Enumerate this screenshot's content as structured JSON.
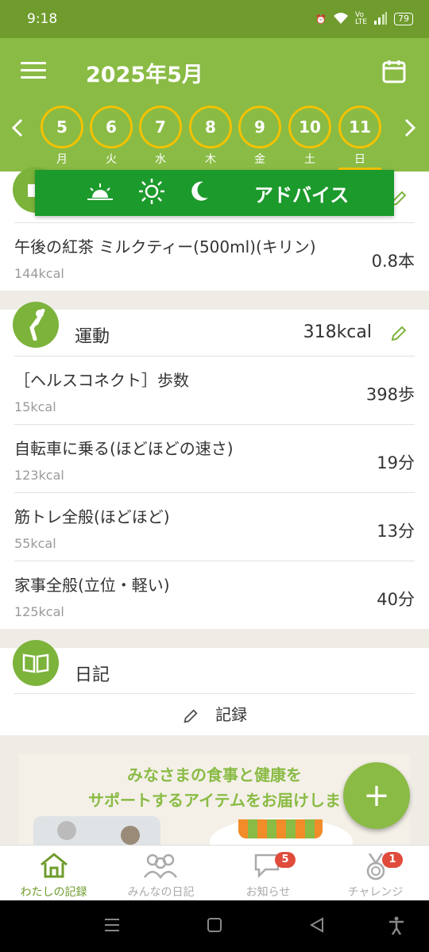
{
  "status": {
    "time": "9:18",
    "battery": "79"
  },
  "header": {
    "title": "2025年5月"
  },
  "days": [
    {
      "num": "5",
      "weekday": "月"
    },
    {
      "num": "6",
      "weekday": "火"
    },
    {
      "num": "7",
      "weekday": "水"
    },
    {
      "num": "8",
      "weekday": "木"
    },
    {
      "num": "9",
      "weekday": "金"
    },
    {
      "num": "10",
      "weekday": "土"
    },
    {
      "num": "11",
      "weekday": "日"
    }
  ],
  "advice": {
    "label": "アドバイス"
  },
  "drink": {
    "name": "午後の紅茶 ミルクティー(500ml)(キリン)",
    "kcal": "144kcal",
    "qty": "0.8本"
  },
  "exercise": {
    "title": "運動",
    "total": "318kcal",
    "items": [
      {
        "name": "［ヘルスコネクト］歩数",
        "kcal": "15kcal",
        "qty": "398歩"
      },
      {
        "name": "自転車に乗る(ほどほどの速さ)",
        "kcal": "123kcal",
        "qty": "19分"
      },
      {
        "name": "筋トレ全般(ほどほど)",
        "kcal": "55kcal",
        "qty": "13分"
      },
      {
        "name": "家事全般(立位・軽い)",
        "kcal": "125kcal",
        "qty": "40分"
      }
    ]
  },
  "diary": {
    "title": "日記",
    "record_label": "記録"
  },
  "banner": {
    "line1": "みなさまの食事と健康を",
    "line2": "サポートするアイテムをお届けしま"
  },
  "fab": {
    "label": "+"
  },
  "tabs": [
    {
      "label": "わたしの記録",
      "badge": ""
    },
    {
      "label": "みんなの日記",
      "badge": ""
    },
    {
      "label": "お知らせ",
      "badge": "5"
    },
    {
      "label": "チャレンジ",
      "badge": "1"
    }
  ],
  "colors": {
    "header": "#8abb45",
    "statusbar": "#6f9c2d",
    "accent": "#f3c200",
    "advice": "#1d9a2c",
    "badge": "#e04b3c"
  }
}
